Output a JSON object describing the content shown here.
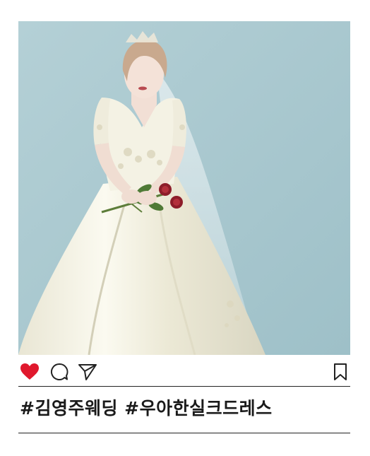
{
  "post": {
    "photo_alt_subject": "bride-in-silk-wedding-dress",
    "colors": {
      "background_wall": "#a9c8cf",
      "like_active": "#e0182d",
      "icon_stroke": "#222222",
      "divider": "#222222",
      "caption_text": "#1a1a1a"
    },
    "actions": {
      "like_icon": "heart-icon",
      "like_state": "liked",
      "comment_icon": "speech-bubble-icon",
      "share_icon": "paper-plane-icon",
      "save_icon": "bookmark-icon"
    },
    "caption": {
      "tag1": "#김영주웨딩",
      "tag2": "#우아한실크드레스"
    }
  }
}
